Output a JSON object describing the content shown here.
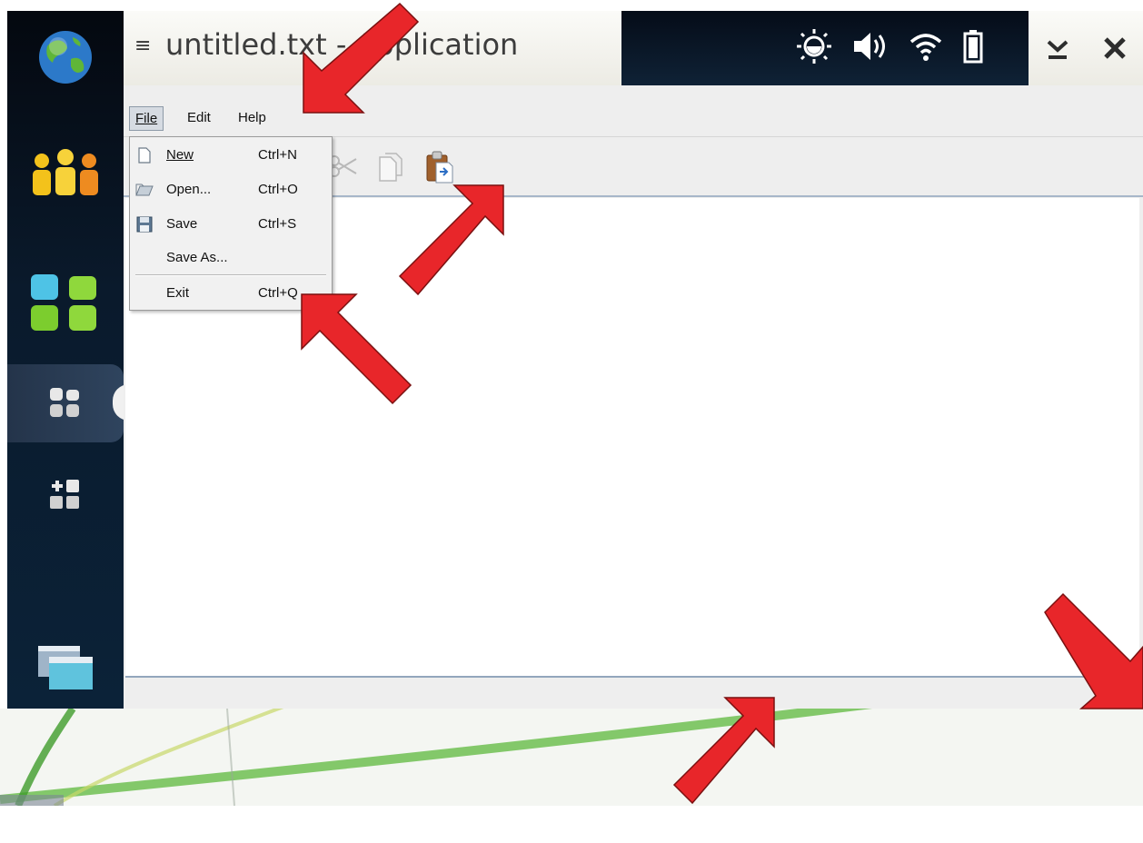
{
  "window": {
    "title": "untitled.txt - Application"
  },
  "sidebar": {
    "items": [
      {
        "name": "web-globe",
        "icon": "globe-icon"
      },
      {
        "name": "contacts",
        "icon": "people-icon"
      },
      {
        "name": "app-grid",
        "icon": "apps-grid-icon"
      },
      {
        "name": "applications",
        "icon": "small-grid-icon",
        "active": true
      },
      {
        "name": "add-widget",
        "icon": "add-grid-icon"
      },
      {
        "name": "task-switcher",
        "icon": "windows-icon"
      }
    ]
  },
  "status_icons": [
    "brightness-icon",
    "volume-icon",
    "wifi-icon",
    "battery-icon"
  ],
  "menubar": {
    "items": [
      {
        "label": "File",
        "mnemonic": "F",
        "open": true
      },
      {
        "label": "Edit",
        "mnemonic": "E"
      },
      {
        "label": "Help",
        "mnemonic": "H"
      }
    ]
  },
  "file_menu": {
    "items": [
      {
        "label": "New",
        "accelerator": "Ctrl+N",
        "icon": "new-document-icon"
      },
      {
        "label": "Open...",
        "accelerator": "Ctrl+O",
        "icon": "open-folder-icon"
      },
      {
        "label": "Save",
        "accelerator": "Ctrl+S",
        "icon": "floppy-save-icon"
      },
      {
        "label": "Save As...",
        "accelerator": "",
        "icon": ""
      },
      {
        "label": "Exit",
        "accelerator": "Ctrl+Q",
        "icon": ""
      }
    ]
  },
  "toolbar": {
    "icons": [
      "cut-icon",
      "copy-icon",
      "paste-icon"
    ]
  },
  "editor": {
    "content": ""
  },
  "colors": {
    "arrow": "#e8262a",
    "screen_bg": "#06101c",
    "window_bg": "#eeeeee",
    "accent_border": "#a7b7c9"
  }
}
